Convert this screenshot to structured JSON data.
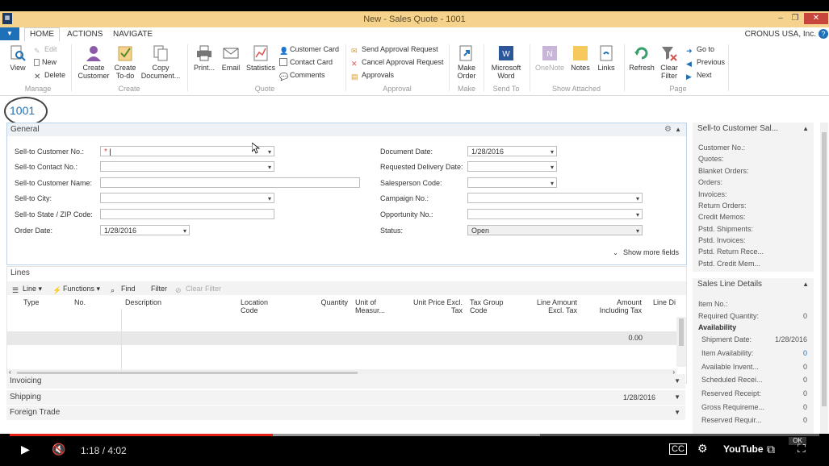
{
  "window": {
    "title": "New - Sales Quote - 1001",
    "company": "CRONUS USA, Inc."
  },
  "tabs": [
    "HOME",
    "ACTIONS",
    "NAVIGATE"
  ],
  "ribbon": {
    "manage": {
      "label": "Manage",
      "view": "View",
      "edit": "Edit",
      "new": "New",
      "delete": "Delete"
    },
    "create": {
      "label": "Create",
      "create_customer": [
        "Create",
        "Customer"
      ],
      "create_todo": [
        "Create",
        "To-do"
      ],
      "copy_document": [
        "Copy",
        "Document..."
      ]
    },
    "quote": {
      "label": "Quote",
      "print": "Print...",
      "email": "Email",
      "statistics": "Statistics",
      "customer_card": "Customer Card",
      "contact_card": "Contact Card",
      "comments": "Comments"
    },
    "approval": {
      "label": "Approval",
      "send": "Send Approval Request",
      "cancel": "Cancel Approval Request",
      "approvals": "Approvals"
    },
    "make": {
      "label": "Make",
      "make_order": [
        "Make",
        "Order"
      ]
    },
    "send_to": {
      "label": "Send To",
      "word": [
        "Microsoft",
        "Word"
      ]
    },
    "show_attached": {
      "label": "Show Attached",
      "onenote": "OneNote",
      "notes": "Notes",
      "links": "Links"
    },
    "page": {
      "label": "Page",
      "refresh": "Refresh",
      "clear_filter": [
        "Clear",
        "Filter"
      ],
      "go_to": "Go to",
      "previous": "Previous",
      "next": "Next"
    }
  },
  "doc_number": "1001",
  "general": {
    "title": "General",
    "show_more": "Show more fields",
    "left": [
      {
        "label": "Sell-to Customer No.:",
        "value": "",
        "required": true
      },
      {
        "label": "Sell-to Contact No.:",
        "value": ""
      },
      {
        "label": "Sell-to Customer Name:",
        "value": ""
      },
      {
        "label": "Sell-to City:",
        "value": ""
      },
      {
        "label": "Sell-to State / ZIP Code:",
        "value": ""
      },
      {
        "label": "Order Date:",
        "value": "1/28/2016"
      }
    ],
    "right": [
      {
        "label": "Document Date:",
        "value": "1/28/2016"
      },
      {
        "label": "Requested Delivery Date:",
        "value": ""
      },
      {
        "label": "Salesperson Code:",
        "value": ""
      },
      {
        "label": "Campaign No.:",
        "value": ""
      },
      {
        "label": "Opportunity No.:",
        "value": ""
      },
      {
        "label": "Status:",
        "value": "Open"
      }
    ]
  },
  "lines": {
    "title": "Lines",
    "toolbar": {
      "line": "Line",
      "functions": "Functions",
      "find": "Find",
      "filter": "Filter",
      "clear_filter": "Clear Filter"
    },
    "columns": [
      "Type",
      "No.",
      "Description",
      "Location Code",
      "Quantity",
      "Unit of Measur...",
      "Unit Price Excl. Tax",
      "Tax Group Code",
      "Line Amount Excl. Tax",
      "Amount Including Tax",
      "Line Di"
    ],
    "row_amount": "0.00"
  },
  "collapsed_tabs": [
    {
      "label": "Invoicing",
      "value": ""
    },
    {
      "label": "Shipping",
      "value": "1/28/2016"
    },
    {
      "label": "Foreign Trade",
      "value": ""
    }
  ],
  "factbox1": {
    "title": "Sell-to Customer Sal...",
    "rows": [
      "Customer No.:",
      "Quotes:",
      "Blanket Orders:",
      "Orders:",
      "Invoices:",
      "Return Orders:",
      "Credit Memos:",
      "Pstd. Shipments:",
      "Pstd. Invoices:",
      "Pstd. Return Rece...",
      "Pstd. Credit Mem..."
    ]
  },
  "factbox2": {
    "title": "Sales Line Details",
    "item_no": "Item No.:",
    "required_qty": {
      "label": "Required Quantity:",
      "value": "0"
    },
    "availability": "Availability",
    "rows": [
      {
        "label": "Shipment Date:",
        "value": "1/28/2016"
      },
      {
        "label": "Item Availability:",
        "value": "0"
      },
      {
        "label": "Available Invent...",
        "value": "0"
      },
      {
        "label": "Scheduled Recei...",
        "value": "0"
      },
      {
        "label": "Reserved Receipt:",
        "value": "0"
      },
      {
        "label": "Gross Requireme...",
        "value": "0"
      },
      {
        "label": "Reserved Requir...",
        "value": "0"
      }
    ]
  },
  "player": {
    "time": "1:18 / 4:02",
    "progress": 0.325,
    "buffered": 0.655,
    "ok": "OK"
  },
  "colors": {
    "titlebar": "#f6d38d",
    "accent": "#1e70b8",
    "progress": "#e62117"
  }
}
